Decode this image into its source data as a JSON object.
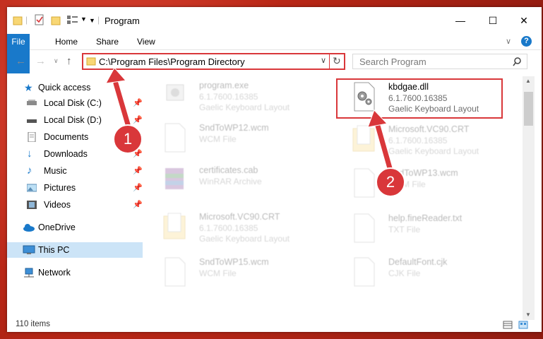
{
  "window": {
    "title": "Program",
    "controls": {
      "minimize": "—",
      "maximize": "☐",
      "close": "✕"
    }
  },
  "ribbon": {
    "tabs": [
      "File",
      "Home",
      "Share",
      "View"
    ],
    "help": "?"
  },
  "address_bar": {
    "path": "C:\\Program Files\\Program Directory"
  },
  "search": {
    "placeholder": "Search Program"
  },
  "sidebar": {
    "items": [
      {
        "label": "Quick access",
        "icon": "star-icon",
        "pinned": false
      },
      {
        "label": "Local Disk (C:)",
        "icon": "drive-icon",
        "pinned": true
      },
      {
        "label": "Local Disk (D:)",
        "icon": "drive-icon",
        "pinned": true
      },
      {
        "label": "Documents",
        "icon": "documents-icon",
        "pinned": true
      },
      {
        "label": "Downloads",
        "icon": "download-icon",
        "pinned": true
      },
      {
        "label": "Music",
        "icon": "music-icon",
        "pinned": true
      },
      {
        "label": "Pictures",
        "icon": "pictures-icon",
        "pinned": true
      },
      {
        "label": "Videos",
        "icon": "videos-icon",
        "pinned": true
      },
      {
        "label": "OneDrive",
        "icon": "cloud-icon",
        "pinned": false
      },
      {
        "label": "This PC",
        "icon": "computer-icon",
        "pinned": false,
        "selected": true
      },
      {
        "label": "Network",
        "icon": "network-icon",
        "pinned": false
      }
    ]
  },
  "files": [
    {
      "name": "program.exe",
      "line2": "6.1.7600.16385",
      "line3": "Gaelic Keyboard Layout",
      "icon": "exe-icon"
    },
    {
      "name": "kbdgae.dll",
      "line2": "6.1.7600.16385",
      "line3": "Gaelic Keyboard Layout",
      "icon": "dll-gear-icon",
      "highlighted": true
    },
    {
      "name": "SndToWP12.wcm",
      "line2": "WCM File",
      "line3": "",
      "icon": "generic-file-icon"
    },
    {
      "name": "Microsoft.VC90.CRT",
      "line2": "6.1.7600.16385",
      "line3": "Gaelic Keyboard Layout",
      "icon": "folder-doc-icon"
    },
    {
      "name": "certificates.cab",
      "line2": "WinRAR Archive",
      "line3": "",
      "icon": "winrar-icon"
    },
    {
      "name": "SndToWP13.wcm",
      "line2": "WCM File",
      "line3": "",
      "icon": "generic-file-icon"
    },
    {
      "name": "Microsoft.VC90.CRT",
      "line2": "6.1.7600.16385",
      "line3": "Gaelic Keyboard Layout",
      "icon": "folder-doc-icon"
    },
    {
      "name": "help.fineReader.txt",
      "line2": "TXT File",
      "line3": "",
      "icon": "generic-file-icon"
    },
    {
      "name": "SndToWP15.wcm",
      "line2": "WCM File",
      "line3": "",
      "icon": "generic-file-icon"
    },
    {
      "name": "DefaultFont.cjk",
      "line2": "CJK File",
      "line3": "",
      "icon": "generic-file-icon"
    }
  ],
  "status": {
    "item_count": "110 items"
  },
  "annotations": [
    {
      "number": "1"
    },
    {
      "number": "2"
    }
  ],
  "colors": {
    "accent": "#1979ca",
    "highlight": "#d9373a",
    "selection": "#cce4f7"
  }
}
